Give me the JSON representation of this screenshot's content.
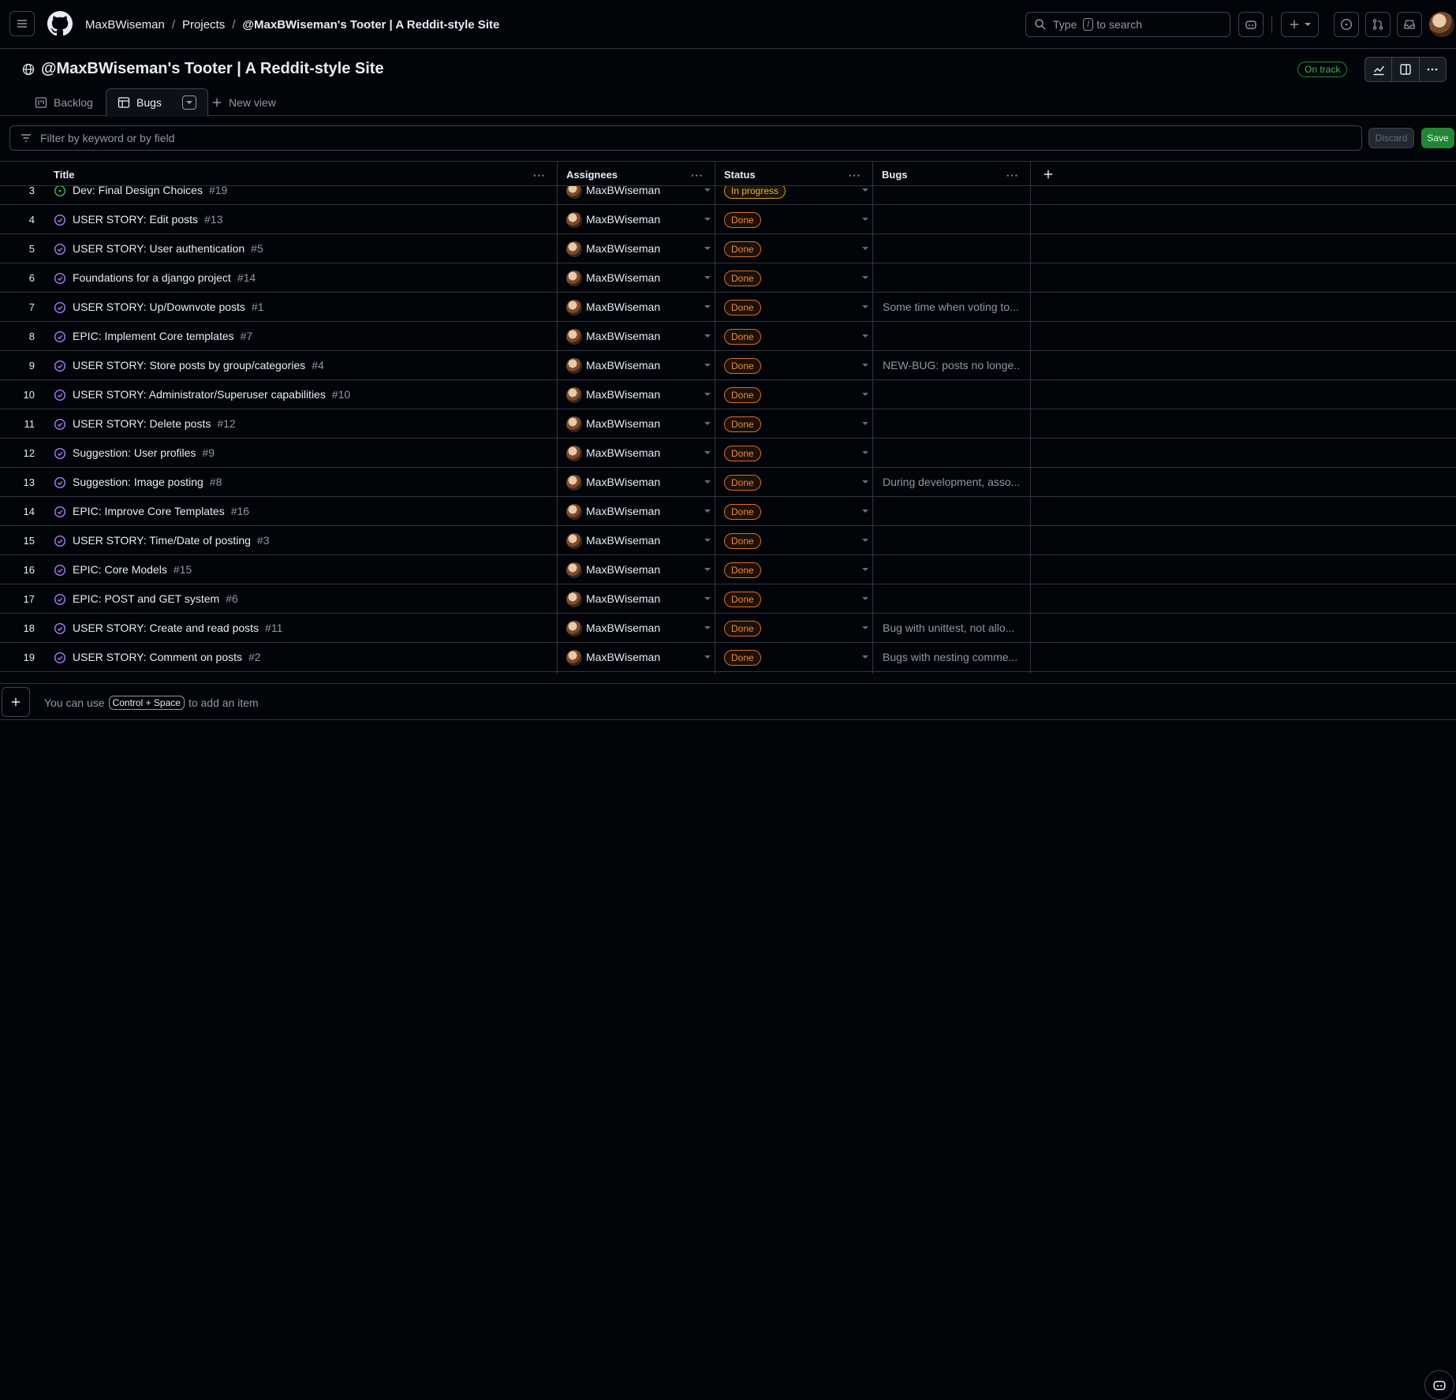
{
  "header": {
    "breadcrumbs": [
      "MaxBWiseman",
      "Projects",
      "@MaxBWiseman's Tooter | A Reddit-style Site"
    ],
    "search_prefix": "Type",
    "search_key": "/",
    "search_suffix": "to search"
  },
  "project": {
    "title": "@MaxBWiseman's Tooter | A Reddit-style Site",
    "status_badge": "On track"
  },
  "tabs": [
    {
      "label": "Backlog",
      "icon": "board-icon"
    },
    {
      "label": "Bugs",
      "icon": "table-icon",
      "active": true
    },
    {
      "label": "New view",
      "icon": "plus-icon"
    }
  ],
  "filter": {
    "placeholder": "Filter by keyword or by field",
    "discard": "Discard",
    "save": "Save"
  },
  "columns": [
    "Title",
    "Assignees",
    "Status",
    "Bugs"
  ],
  "rows": [
    {
      "n": "3",
      "title": "Dev: Final Design Choices",
      "issue": "#19",
      "state": "open",
      "assignee": "MaxBWiseman",
      "status": "In progress",
      "bug": ""
    },
    {
      "n": "4",
      "title": "USER STORY: Edit posts",
      "issue": "#13",
      "state": "closed",
      "assignee": "MaxBWiseman",
      "status": "Done",
      "bug": ""
    },
    {
      "n": "5",
      "title": "USER STORY: User authentication",
      "issue": "#5",
      "state": "closed",
      "assignee": "MaxBWiseman",
      "status": "Done",
      "bug": ""
    },
    {
      "n": "6",
      "title": "Foundations for a django project",
      "issue": "#14",
      "state": "closed",
      "assignee": "MaxBWiseman",
      "status": "Done",
      "bug": ""
    },
    {
      "n": "7",
      "title": "USER STORY: Up/Downvote posts",
      "issue": "#1",
      "state": "closed",
      "assignee": "MaxBWiseman",
      "status": "Done",
      "bug": "Some time when voting to..."
    },
    {
      "n": "8",
      "title": "EPIC: Implement Core templates",
      "issue": "#7",
      "state": "closed",
      "assignee": "MaxBWiseman",
      "status": "Done",
      "bug": ""
    },
    {
      "n": "9",
      "title": "USER STORY: Store posts by group/categories",
      "issue": "#4",
      "state": "closed",
      "assignee": "MaxBWiseman",
      "status": "Done",
      "bug": "NEW-BUG: posts no longe..."
    },
    {
      "n": "10",
      "title": "USER STORY: Administrator/Superuser capabilities",
      "issue": "#10",
      "state": "closed",
      "assignee": "MaxBWiseman",
      "status": "Done",
      "bug": ""
    },
    {
      "n": "11",
      "title": "USER STORY: Delete posts",
      "issue": "#12",
      "state": "closed",
      "assignee": "MaxBWiseman",
      "status": "Done",
      "bug": ""
    },
    {
      "n": "12",
      "title": "Suggestion: User profiles",
      "issue": "#9",
      "state": "closed",
      "assignee": "MaxBWiseman",
      "status": "Done",
      "bug": ""
    },
    {
      "n": "13",
      "title": "Suggestion: Image posting",
      "issue": "#8",
      "state": "closed",
      "assignee": "MaxBWiseman",
      "status": "Done",
      "bug": "During development, asso..."
    },
    {
      "n": "14",
      "title": "EPIC: Improve Core Templates",
      "issue": "#16",
      "state": "closed",
      "assignee": "MaxBWiseman",
      "status": "Done",
      "bug": ""
    },
    {
      "n": "15",
      "title": "USER STORY: Time/Date of posting",
      "issue": "#3",
      "state": "closed",
      "assignee": "MaxBWiseman",
      "status": "Done",
      "bug": ""
    },
    {
      "n": "16",
      "title": "EPIC: Core Models",
      "issue": "#15",
      "state": "closed",
      "assignee": "MaxBWiseman",
      "status": "Done",
      "bug": ""
    },
    {
      "n": "17",
      "title": "EPIC: POST and GET system",
      "issue": "#6",
      "state": "closed",
      "assignee": "MaxBWiseman",
      "status": "Done",
      "bug": ""
    },
    {
      "n": "18",
      "title": "USER STORY: Create and read posts",
      "issue": "#11",
      "state": "closed",
      "assignee": "MaxBWiseman",
      "status": "Done",
      "bug": "Bug with unittest, not allo..."
    },
    {
      "n": "19",
      "title": "USER STORY: Comment on posts",
      "issue": "#2",
      "state": "closed",
      "assignee": "MaxBWiseman",
      "status": "Done",
      "bug": "Bugs with nesting comme..."
    }
  ],
  "add_item": {
    "prefix": "You can use",
    "shortcut": "Control + Space",
    "suffix": "to add an item"
  },
  "colors": {
    "background": "#010409",
    "done": "#f0883e",
    "in_progress": "#e3b341",
    "open_icon": "#3fb950",
    "closed_icon": "#ab7df8",
    "on_track": "#3fb950",
    "save": "#238636"
  }
}
